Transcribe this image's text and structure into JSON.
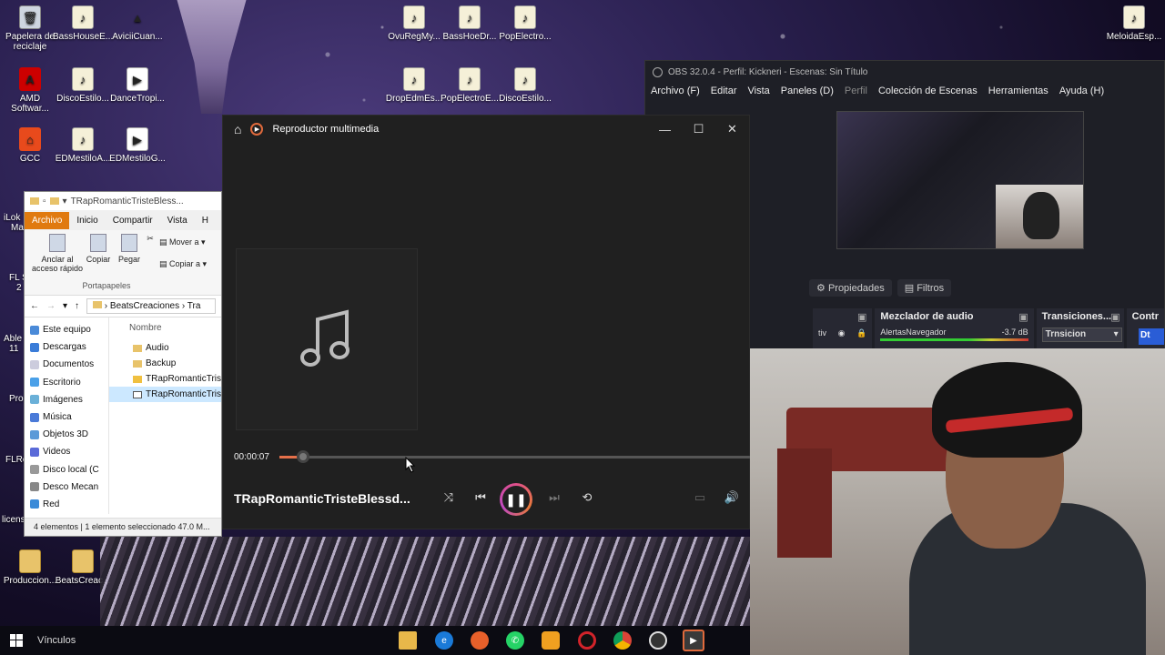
{
  "desktop_icons": [
    {
      "label": "Papelera de reciclaje",
      "icon": "recycle-bin-icon"
    },
    {
      "label": "BassHouseE...",
      "icon": "audio-file-icon"
    },
    {
      "label": "AviciiCuan...",
      "icon": "vlc-icon"
    },
    {
      "label": "OvuRegMy...",
      "icon": "audio-file-icon"
    },
    {
      "label": "BassHoeDr...",
      "icon": "audio-file-icon"
    },
    {
      "label": "PopElectro...",
      "icon": "audio-file-icon"
    },
    {
      "label": "MeloidaEsp...",
      "icon": "audio-file-icon"
    },
    {
      "label": "AMD Softwar...",
      "icon": "amd-icon"
    },
    {
      "label": "DiscoEstilo...",
      "icon": "audio-file-icon"
    },
    {
      "label": "DanceTropi...",
      "icon": "media-file-icon"
    },
    {
      "label": "DropEdmEs...",
      "icon": "audio-file-icon"
    },
    {
      "label": "PopElectroE...",
      "icon": "audio-file-icon"
    },
    {
      "label": "DiscoEstilo...",
      "icon": "audio-file-icon"
    },
    {
      "label": "GCC",
      "icon": "gcc-icon"
    },
    {
      "label": "EDMestiloA...",
      "icon": "audio-file-icon"
    },
    {
      "label": "EDMestiloG...",
      "icon": "media-file-icon"
    },
    {
      "label": "Produccion...",
      "icon": "folder-icon"
    },
    {
      "label": "BeatsCreac...",
      "icon": "folder-icon"
    }
  ],
  "desktop_partial_labels": [
    "iLok",
    "Ma",
    "FL S",
    "2",
    "Able",
    "11",
    "Pro",
    "FLRe",
    "licens"
  ],
  "obs": {
    "title": "OBS 32.0.4 - Perfil: Kickneri - Escenas: Sin Título",
    "menu": [
      "Archivo (F)",
      "Editar",
      "Vista",
      "Paneles (D)",
      "Perfil",
      "Colección de Escenas",
      "Herramientas",
      "Ayuda (H)"
    ],
    "tabs": [
      "Propiedades",
      "Filtros"
    ],
    "dock_partial": "tiv",
    "mixer_title": "Mezclador de audio",
    "mixer_source": "AlertasNavegador",
    "mixer_db": "-3.7 dB",
    "transitions_title": "Transiciones...",
    "transition_value": "Trnsicion",
    "controls_title": "Contr",
    "controls_button": "Dt"
  },
  "explorer": {
    "title": "TRapRomanticTristeBless...",
    "tabs": [
      "Archivo",
      "Inicio",
      "Compartir",
      "Vista",
      "H"
    ],
    "ribbon": {
      "pin": "Anclar al acceso rápido",
      "copy": "Copiar",
      "paste": "Pegar",
      "move": "Mover a",
      "copy_to": "Copiar a",
      "group": "Portapapeles"
    },
    "path": [
      "BeatsCreaciones",
      "Tra"
    ],
    "nav": [
      "Este equipo",
      "Descargas",
      "Documentos",
      "Escritorio",
      "Imágenes",
      "Música",
      "Objetos 3D",
      "Videos",
      "Disco local (C",
      "Desco Mecan",
      "Red"
    ],
    "column_header": "Nombre",
    "files": [
      "Audio",
      "Backup",
      "TRapRomanticTris",
      "TRapRomanticTris"
    ],
    "status": "4 elementos  |  1 elemento seleccionado  47.0 M..."
  },
  "player": {
    "home_icon": "home-icon",
    "title": "Reproductor multimedia",
    "elapsed": "00:00:07",
    "progress": 0.05,
    "song": "TRapRomanticTristeBlessd...",
    "accent": "#e5704a"
  },
  "taskbar": {
    "label": "Vínculos",
    "apps": [
      "explorer",
      "edge",
      "firefox",
      "whatsapp",
      "fl-studio",
      "opera",
      "chrome",
      "obs",
      "media-player"
    ]
  }
}
